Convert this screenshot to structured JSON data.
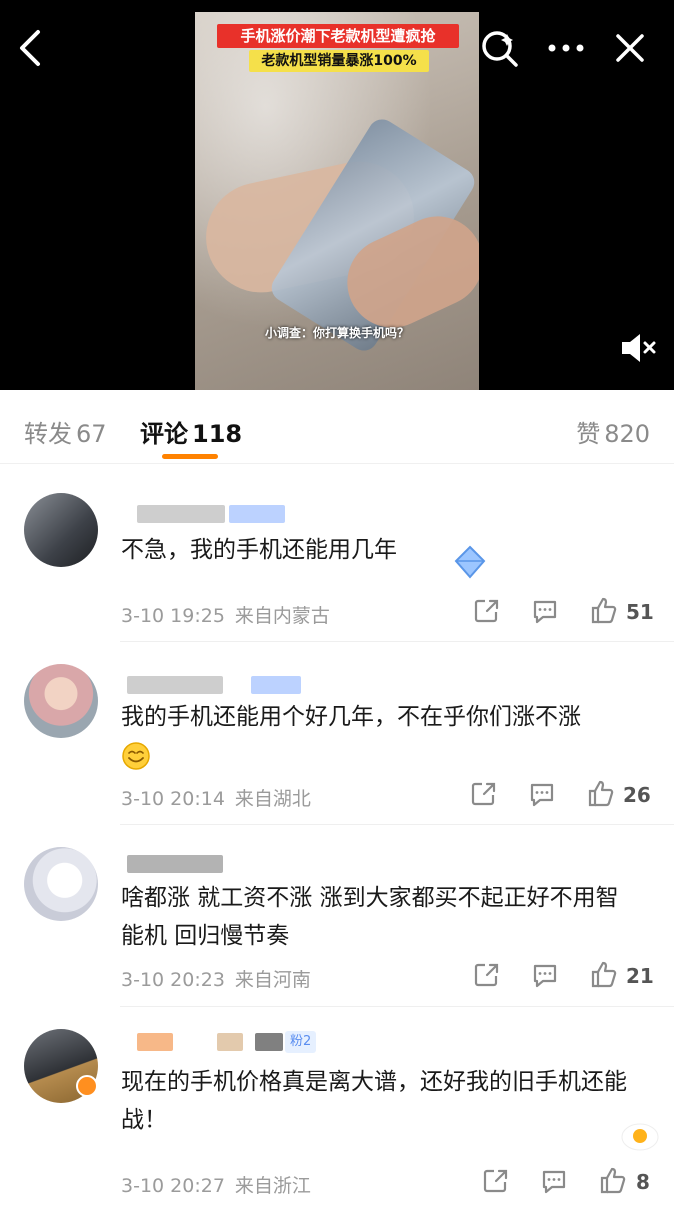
{
  "video": {
    "title": "手机涨价潮下老款机型遭疯抢",
    "subtitle": "老款机型销量暴涨100%",
    "caption": "小调查：你打算换手机吗？"
  },
  "top_bar": {
    "icons": [
      "back-icon",
      "search-icon",
      "more-icon",
      "close-icon"
    ],
    "mute_icon": "mute-icon"
  },
  "tabs": {
    "forward_label": "转发",
    "forward_count": "67",
    "comments_label": "评论",
    "comments_count": "118",
    "likes_label": "赞",
    "likes_count": "820",
    "accent": "#ff8200"
  },
  "comments": [
    {
      "text": "不急，我的手机还能用几年",
      "date": "3-10 19:25",
      "location": "来自内蒙古",
      "likes": "51"
    },
    {
      "text": "我的手机还能用个好几年，不在乎你们涨不涨",
      "date": "3-10 20:14",
      "location": "来自湖北",
      "likes": "26"
    },
    {
      "text": "啥都涨 就工资不涨 涨到大家都买不起正好不用智能机 回归慢节奏",
      "date": "3-10 20:23",
      "location": "来自河南",
      "likes": "21"
    },
    {
      "text": "现在的手机价格真是离大谱，还好我的旧手机还能战！",
      "date": "3-10 20:27",
      "location": "来自浙江",
      "likes": "8",
      "fan_badge": "粉2"
    }
  ]
}
